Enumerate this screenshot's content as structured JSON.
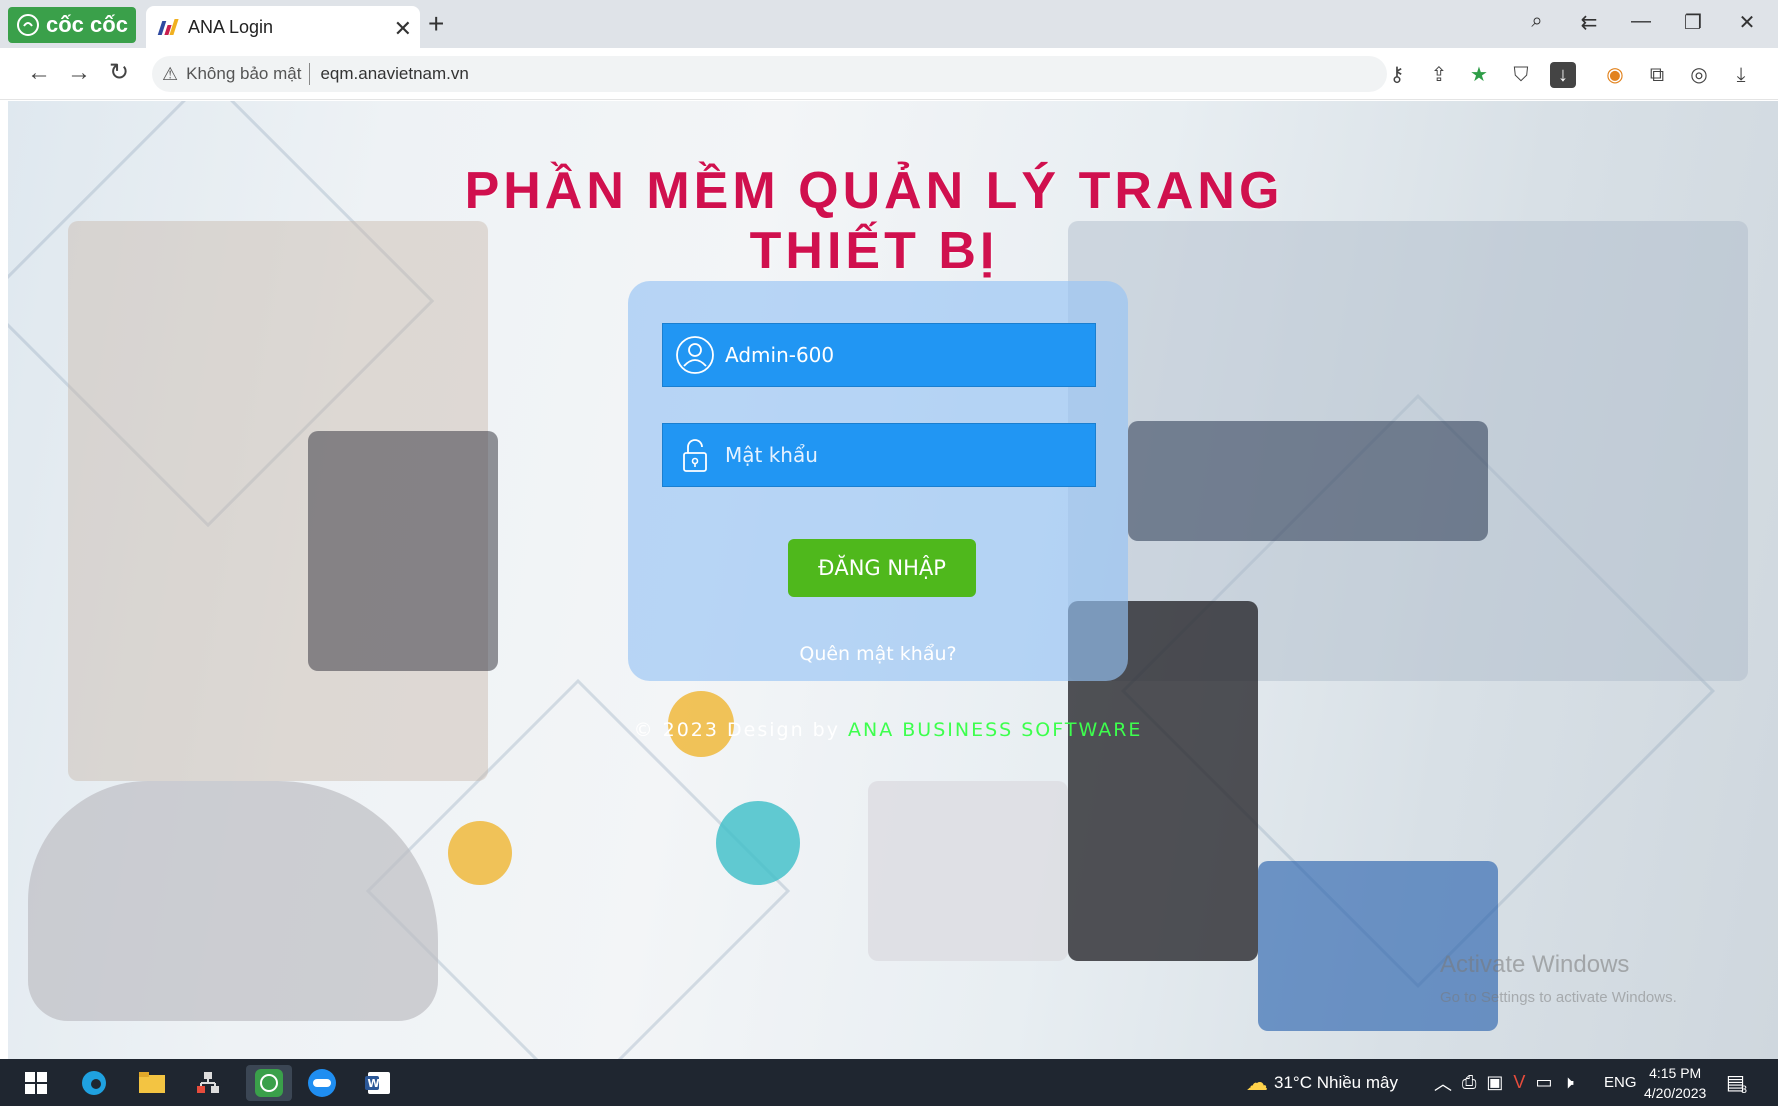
{
  "browser": {
    "brand": "cốc cốc",
    "tab_title": "ANA Login",
    "security_label": "Không bảo mật",
    "url": "eqm.anavietnam.vn"
  },
  "page": {
    "headline": "PHẦN MỀM QUẢN LÝ TRANG THIẾT BỊ",
    "username_value": "Admin-600",
    "password_placeholder": "Mật khẩu",
    "login_button": "ĐĂNG NHẬP",
    "forgot_link": "Quên mật khẩu?",
    "footer_prefix": "© 2023 Design by",
    "footer_brand": "ANA BUSINESS SOFTWARE",
    "watermark_title": "Activate Windows",
    "watermark_sub": "Go to Settings to activate Windows."
  },
  "taskbar": {
    "weather": "31°C  Nhiều mây",
    "language": "ENG",
    "time": "4:15 PM",
    "date": "4/20/2023",
    "notifications": "3"
  },
  "colors": {
    "headline": "#d0104e",
    "field_bg": "#2196f3",
    "login_bg": "#4fb81c",
    "footer_brand": "#3dff4d",
    "brand_green": "#3aa04a"
  }
}
